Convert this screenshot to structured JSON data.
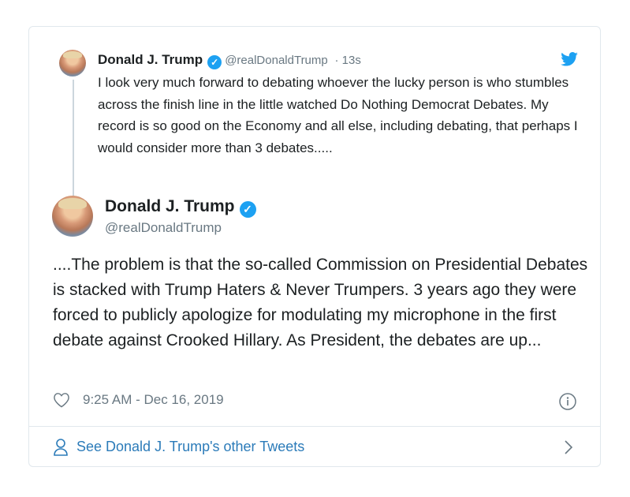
{
  "quoted_tweet": {
    "name": "Donald J. Trump",
    "verified_icon": "verified-badge-icon",
    "handle": "@realDonaldTrump",
    "time": "· 13s",
    "text": "I look very much forward to debating whoever the lucky person is who stumbles across the finish line in the little watched Do Nothing Democrat Debates. My record is so good on the Economy and all else, including debating, that perhaps I would consider more than 3 debates....."
  },
  "main_tweet": {
    "name": "Donald J. Trump",
    "handle": "@realDonaldTrump",
    "text": "....The problem is that the so-called Commission on Presidential Debates is stacked with Trump Haters & Never Trumpers. 3 years ago they were forced to publicly apologize for modulating my microphone in the first debate against Crooked Hillary. As President, the debates are up...",
    "timestamp": "9:25 AM - Dec 16, 2019"
  },
  "footer": {
    "see_more_label": "See Donald J. Trump's other Tweets"
  },
  "colors": {
    "accent": "#1da1f2",
    "link": "#2b7bb9",
    "muted": "#697882"
  }
}
